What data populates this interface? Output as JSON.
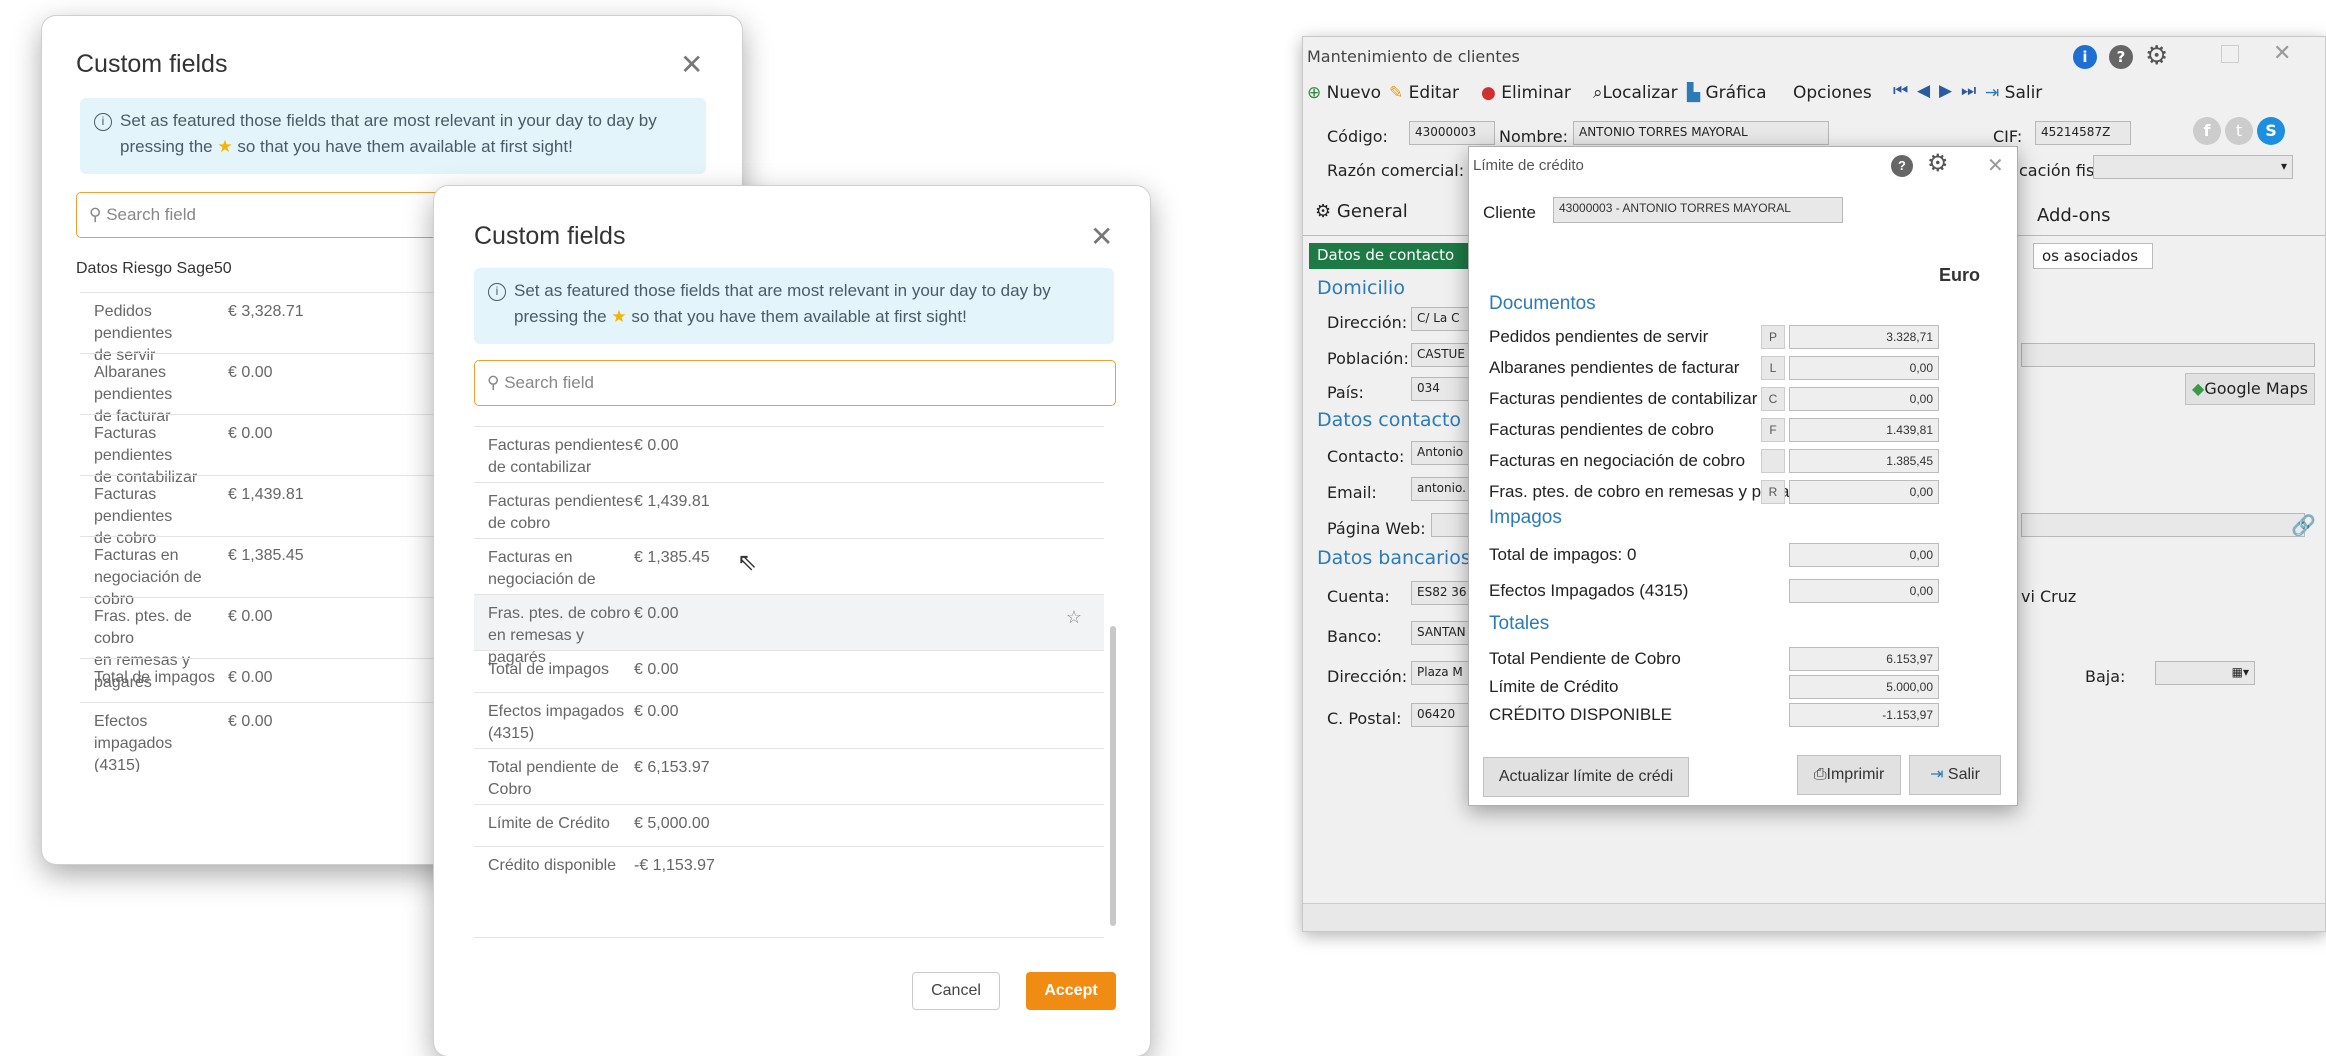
{
  "modal1": {
    "title": "Custom fields",
    "info_line1": "Set as featured those fields that are most relevant in your day to day by",
    "info_line2_pre": "pressing the",
    "info_line2_post": "so that you have them available at first sight!",
    "search_placeholder": "Search field",
    "section": "Datos Riesgo Sage50",
    "rows": [
      {
        "k1": "Pedidos pendientes",
        "k2": "de servir",
        "v": "€ 3,328.71"
      },
      {
        "k1": "Albaranes pendientes",
        "k2": "de facturar",
        "v": "€ 0.00"
      },
      {
        "k1": "Facturas pendientes",
        "k2": "de contabilizar",
        "v": "€ 0.00"
      },
      {
        "k1": "Facturas pendientes",
        "k2": "de cobro",
        "v": "€ 1,439.81"
      },
      {
        "k1": "Facturas en",
        "k2": "negociación de cobro",
        "v": "€ 1,385.45"
      },
      {
        "k1": "Fras. ptes. de cobro",
        "k2": "en remesas y pagarés",
        "v": "€ 0.00"
      },
      {
        "k1": "Total de impagos",
        "k2": "",
        "v": "€ 0.00"
      },
      {
        "k1": "Efectos impagados",
        "k2": "(4315)",
        "v": "€ 0.00"
      }
    ]
  },
  "modal2": {
    "title": "Custom fields",
    "info_line1": "Set as featured those fields that are most relevant in your day to day by",
    "info_line2_pre": "pressing the",
    "info_line2_post": "so that you have them available at first sight!",
    "search_placeholder": "Search field",
    "rows": [
      {
        "k1": "Facturas pendientes",
        "k2": "de contabilizar",
        "v": "€ 0.00"
      },
      {
        "k1": "Facturas pendientes",
        "k2": "de cobro",
        "v": "€ 1,439.81"
      },
      {
        "k1": "Facturas en",
        "k2": "negociación de cobro",
        "v": "€ 1,385.45"
      },
      {
        "k1": "Fras. ptes. de cobro",
        "k2": "en remesas y pagarés",
        "v": "€ 0.00"
      },
      {
        "k1": "Total de impagos",
        "k2": "",
        "v": "€ 0.00"
      },
      {
        "k1": "Efectos impagados",
        "k2": "(4315)",
        "v": "€ 0.00"
      },
      {
        "k1": "Total pendiente de",
        "k2": "Cobro",
        "v": "€ 6,153.97"
      },
      {
        "k1": "Límite de Crédito",
        "k2": "",
        "v": "€ 5,000.00"
      },
      {
        "k1": "Crédito disponible",
        "k2": "",
        "v": "-€ 1,153.97"
      }
    ],
    "cancel": "Cancel",
    "accept": "Accept"
  },
  "app": {
    "title": "Mantenimiento de clientes",
    "toolbar": [
      "Nuevo",
      "Editar",
      "Eliminar",
      "Localizar",
      "Gráfica",
      "Opciones",
      "Salir"
    ],
    "codigo_label": "Código:",
    "codigo_value": "43000003",
    "nombre_label": "Nombre:",
    "nombre_value": "ANTONIO TORRES MAYORAL",
    "cif_label": "CIF:",
    "cif_value": "45214587Z",
    "razon_label": "Razón comercial:",
    "ubicacion_partial": "cación fis",
    "tab_general": "General",
    "tab_addons": "Add-ons",
    "subtab_contacto": "Datos de contacto",
    "subtab_asociados": "os asociados",
    "sec_domicilio": "Domicilio",
    "direccion_label": "Dirección:",
    "direccion_value": "C/ La C",
    "poblacion_label": "Población:",
    "poblacion_value": "CASTUE",
    "pais_label": "País:",
    "pais_value": "034",
    "google_maps": "Google Maps",
    "sec_contacto": "Datos contacto",
    "contacto_label": "Contacto:",
    "contacto_value": "Antonio",
    "email_label": "Email:",
    "email_value": "antonio.",
    "web_label": "Página Web:",
    "sec_bancarios": "Datos bancarios",
    "cuenta_label": "Cuenta:",
    "cuenta_value": "ES82 36",
    "cruz_partial": "vi Cruz",
    "banco_label": "Banco:",
    "banco_value": "SANTAN",
    "dir2_label": "Dirección:",
    "dir2_value": "Plaza M",
    "baja_label": "Baja:",
    "cpostal_label": "C. Postal:",
    "cpostal_value": "06420"
  },
  "credit_dialog": {
    "title": "Límite de crédito",
    "cliente_label": "Cliente",
    "cliente_value": "43000003 - ANTONIO TORRES MAYORAL",
    "currency": "Euro",
    "sec_documentos": "Documentos",
    "docs": [
      {
        "label": "Pedidos pendientes de servir",
        "code": "P",
        "value": "3.328,71"
      },
      {
        "label": "Albaranes pendientes de facturar",
        "code": "L",
        "value": "0,00"
      },
      {
        "label": "Facturas pendientes de contabilizar",
        "code": "C",
        "value": "0,00"
      },
      {
        "label": "Facturas pendientes de cobro",
        "code": "F",
        "value": "1.439,81"
      },
      {
        "label": "Facturas en negociación de cobro",
        "code": "",
        "value": "1.385,45"
      },
      {
        "label": "Fras. ptes. de cobro en remesas y pagarés",
        "code": "R",
        "value": "0,00"
      }
    ],
    "sec_impagos": "Impagos",
    "impagos": [
      {
        "label": "Total de impagos: 0",
        "value": "0,00"
      },
      {
        "label": "Efectos Impagados (4315)",
        "value": "0,00"
      }
    ],
    "sec_totales": "Totales",
    "totales": [
      {
        "label": "Total Pendiente de Cobro",
        "value": "6.153,97"
      },
      {
        "label": "Límite de Crédito",
        "value": "5.000,00"
      },
      {
        "label": "CRÉDITO DISPONIBLE",
        "value": "-1.153,97"
      }
    ],
    "btn_actualizar": "Actualizar límite de crédi",
    "btn_imprimir": "Imprimir",
    "btn_salir": "Salir"
  },
  "colors": {
    "accent": "#f08c14",
    "info_bg": "#e3f4fb",
    "win_blue": "#2b7bb9",
    "win_green": "#2b8a3e"
  }
}
